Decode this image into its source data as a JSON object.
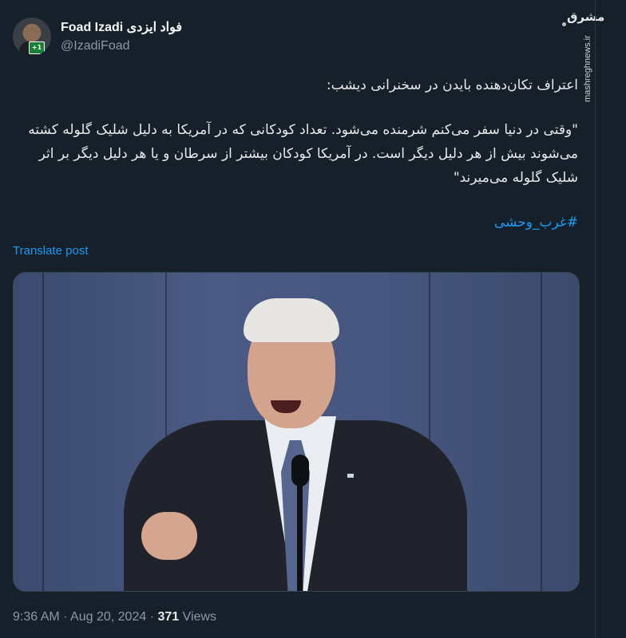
{
  "author": {
    "name": "Foad Izadi فواد ایزدی",
    "handle": "@IzadiFoad",
    "avatar_badge": "+1"
  },
  "watermark": {
    "logo": "مشرق",
    "url": "mashreghnews.ir"
  },
  "tweet": {
    "line1": "اعتراف تکان‌دهنده بایدن در سخنرانی دیشب:",
    "quote": "\"وقتی در دنیا سفر می‌کنم شرمنده می‌شود. تعداد کودکانی که در آمریکا به دلیل شلیک گلوله کشته می‌شوند بیش از هر دلیل دیگر است. در آمریکا کودکان بیشتر از سرطان و یا هر دلیل دیگر بر اثر شلیک گلوله می‌میرند\"",
    "hashtag": "#غرب_وحشی"
  },
  "translate_label": "Translate post",
  "meta": {
    "time": "9:36 AM",
    "date": "Aug 20, 2024",
    "views_count": "371",
    "views_label": "Views",
    "separator": "·"
  },
  "icons": {
    "more": "more-icon"
  },
  "colors": {
    "background": "#15202b",
    "link": "#1d9bf0",
    "secondary": "#8b98a5"
  }
}
